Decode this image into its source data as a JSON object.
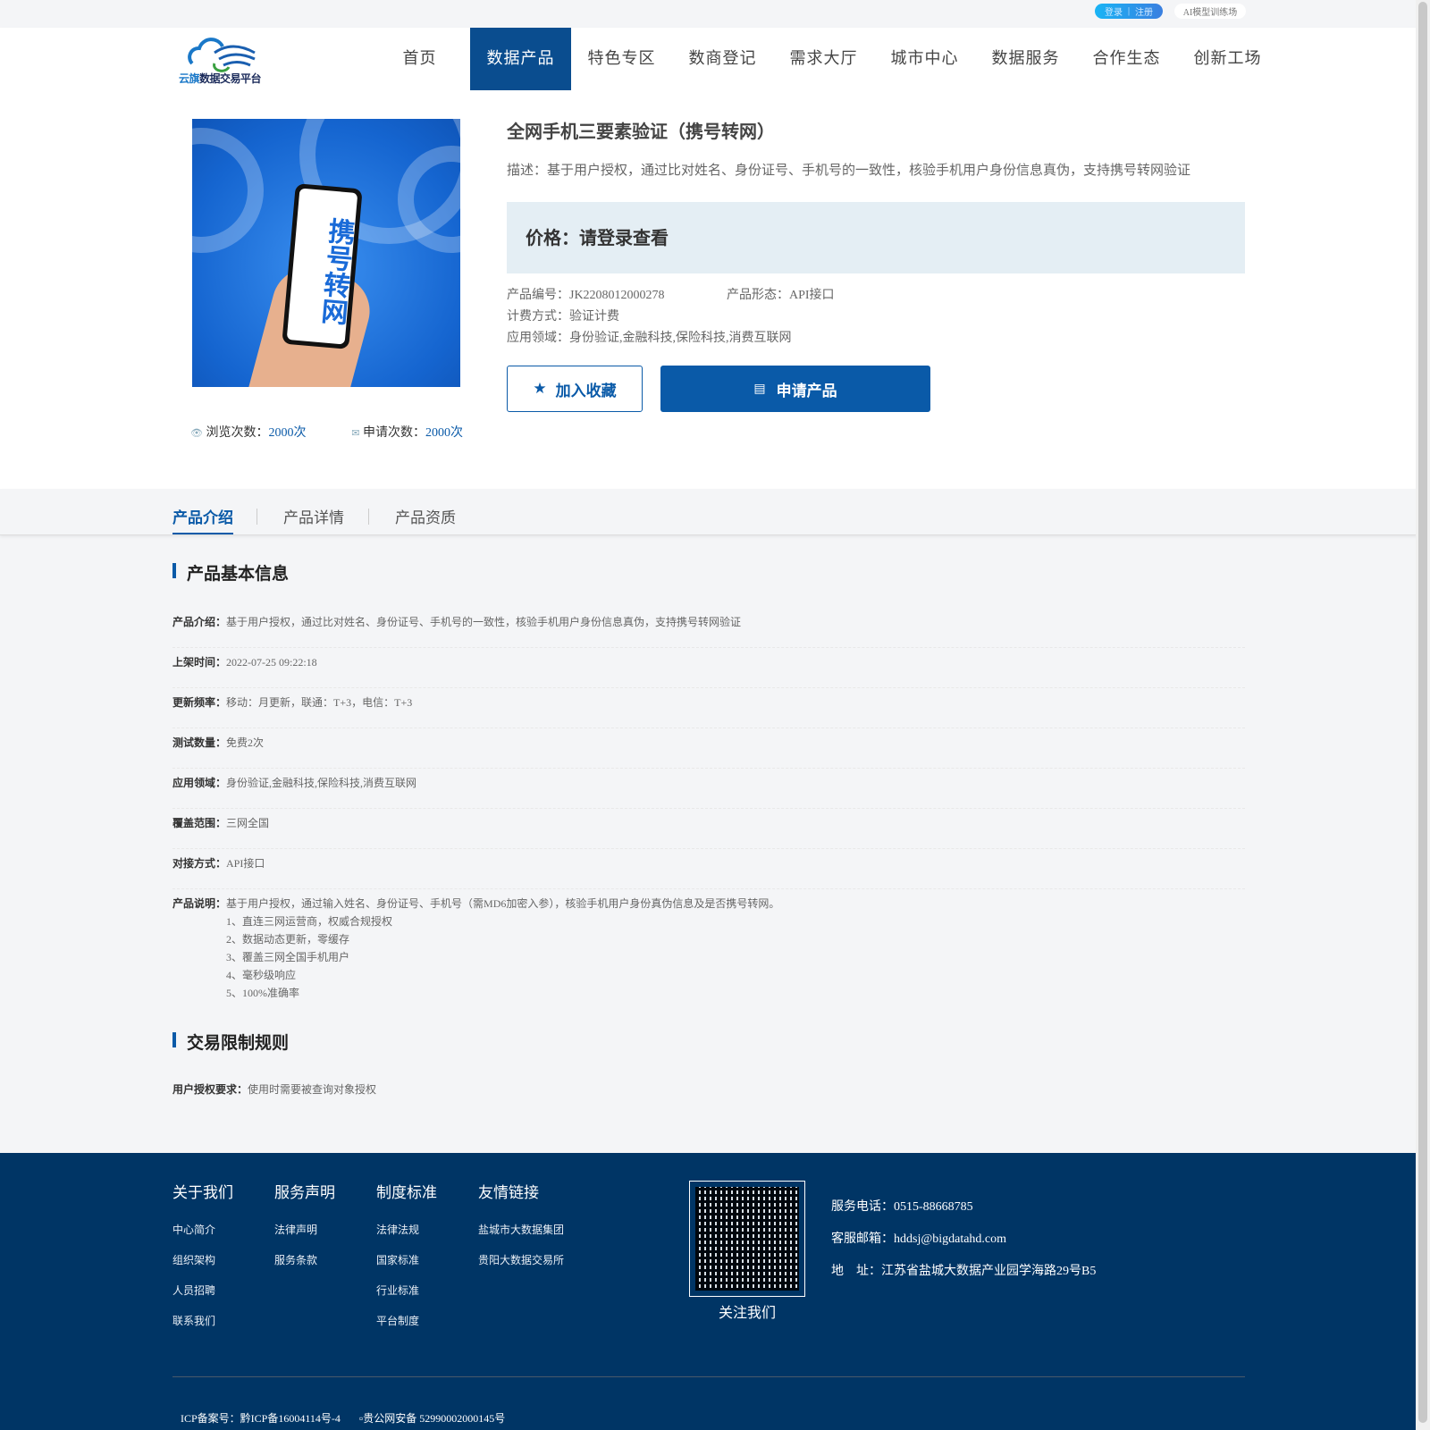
{
  "topbar": {
    "login": "登录",
    "register": "注册",
    "ai": "AI模型训练场"
  },
  "logo": {
    "text_a": "云旗",
    "text_b": "数据交易平台"
  },
  "nav": [
    "首页",
    "数据产品",
    "特色专区",
    "数商登记",
    "需求大厅",
    "城市中心",
    "数据服务",
    "合作生态",
    "创新工场"
  ],
  "product": {
    "image_text": "携号转网",
    "title": "全网手机三要素验证（携号转网）",
    "desc": "描述：基于用户授权，通过比对姓名、身份证号、手机号的一致性，核验手机用户身份信息真伪，支持携号转网验证",
    "price": "价格：请登录查看",
    "code_label": "产品编号：",
    "code": "JK2208012000278",
    "form_label": "产品形态：",
    "form": "API接口",
    "billing_label": "计费方式：",
    "billing": "验证计费",
    "field_label": "应用领域：",
    "field": "身份验证,金融科技,保险科技,消费互联网",
    "fav": "加入收藏",
    "apply": "申请产品",
    "views_label": "浏览次数：",
    "views": "2000次",
    "applies_label": "申请次数：",
    "applies": "2000次"
  },
  "tabs": [
    "产品介绍",
    "产品详情",
    "产品资质"
  ],
  "basic": {
    "title": "产品基本信息",
    "rows": [
      {
        "k": "产品介绍：",
        "v": "基于用户授权，通过比对姓名、身份证号、手机号的一致性，核验手机用户身份信息真伪，支持携号转网验证"
      },
      {
        "k": "上架时间：",
        "v": "2022-07-25 09:22:18"
      },
      {
        "k": "更新频率：",
        "v": "移动：月更新，联通：T+3，电信：T+3"
      },
      {
        "k": "测试数量：",
        "v": "免费2次"
      },
      {
        "k": "应用领域：",
        "v": "身份验证,金融科技,保险科技,消费互联网"
      },
      {
        "k": "覆盖范围：",
        "v": "三网全国"
      },
      {
        "k": "对接方式：",
        "v": "API接口"
      },
      {
        "k": "产品说明：",
        "v": "基于用户授权，通过输入姓名、身份证号、手机号（需MD6加密入参），核验手机用户身份真伪信息及是否携号转网。"
      }
    ],
    "list": [
      "1、直连三网运营商，权威合规授权",
      "2、数据动态更新，零缓存",
      "3、覆盖三网全国手机用户",
      "4、毫秒级响应",
      "5、100%准确率"
    ]
  },
  "rules": {
    "title": "交易限制规则",
    "k": "用户授权要求：",
    "v": "使用时需要被查询对象授权"
  },
  "footer": {
    "cols": [
      {
        "h": "关于我们",
        "items": [
          "中心简介",
          "组织架构",
          "人员招聘",
          "联系我们"
        ]
      },
      {
        "h": "服务声明",
        "items": [
          "法律声明",
          "服务条款"
        ]
      },
      {
        "h": "制度标准",
        "items": [
          "法律法规",
          "国家标准",
          "行业标准",
          "平台制度"
        ]
      },
      {
        "h": "友情链接",
        "items": [
          "盐城市大数据集团",
          "贵阳大数据交易所"
        ]
      }
    ],
    "follow": "关注我们",
    "phone": "服务电话：0515-88668785",
    "email": "客服邮箱：hddsj@bigdatahd.com",
    "addr": "地　址：江苏省盐城大数据产业园学海路29号B5",
    "icp": "ICP备案号：黔ICP备16004114号-4",
    "police": "贵公网安备 52990002000145号"
  }
}
